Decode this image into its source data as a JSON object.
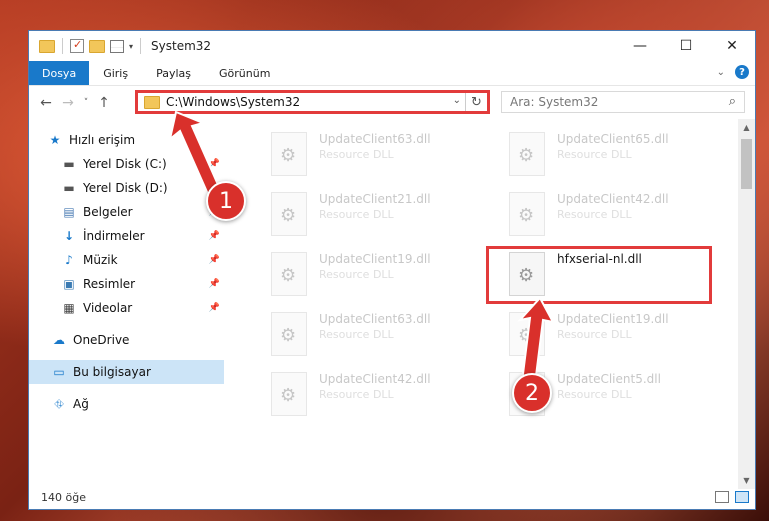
{
  "window": {
    "title": "System32"
  },
  "window_controls": {
    "minimize": "—",
    "maximize": "☐",
    "close": "✕"
  },
  "ribbon": {
    "tabs": [
      "Dosya",
      "Giriş",
      "Paylaş",
      "Görünüm"
    ],
    "active_tab": "Dosya"
  },
  "address": {
    "path": "C:\\Windows\\System32"
  },
  "search": {
    "placeholder": "Ara: System32"
  },
  "nav": {
    "items": [
      {
        "label": "Hızlı erişim",
        "icon": "star-icon"
      },
      {
        "label": "Yerel Disk (C:)",
        "icon": "drive-icon"
      },
      {
        "label": "Yerel Disk (D:)",
        "icon": "drive-icon"
      },
      {
        "label": "Belgeler",
        "icon": "documents-icon"
      },
      {
        "label": "İndirmeler",
        "icon": "download-icon"
      },
      {
        "label": "Müzik",
        "icon": "music-icon"
      },
      {
        "label": "Resimler",
        "icon": "pictures-icon"
      },
      {
        "label": "Videolar",
        "icon": "video-icon"
      },
      {
        "label": "OneDrive",
        "icon": "cloud-icon"
      },
      {
        "label": "Bu bilgisayar",
        "icon": "computer-icon"
      },
      {
        "label": "Ağ",
        "icon": "network-icon"
      }
    ],
    "selected": "Bu bilgisayar"
  },
  "files": [
    {
      "name": "UpdateClient63.dll",
      "type": "Resource DLL"
    },
    {
      "name": "UpdateClient65.dll",
      "type": "Resource DLL"
    },
    {
      "name": "UpdateClient21.dll",
      "type": "Resource DLL"
    },
    {
      "name": "UpdateClient42.dll",
      "type": "Resource DLL"
    },
    {
      "name": "UpdateClient19.dll",
      "type": "Resource DLL"
    },
    {
      "name": "hfxserial-nl.dll",
      "type": ""
    },
    {
      "name": "UpdateClient63.dll",
      "type": "Resource DLL"
    },
    {
      "name": "UpdateClient19.dll",
      "type": "Resource DLL"
    },
    {
      "name": "UpdateClient42.dll",
      "type": "Resource DLL"
    },
    {
      "name": "UpdateClient5.dll",
      "type": "Resource DLL"
    }
  ],
  "status": {
    "count": "140 öğe"
  },
  "annotations": {
    "step1": "1",
    "step2": "2",
    "color": "#d9302b"
  }
}
